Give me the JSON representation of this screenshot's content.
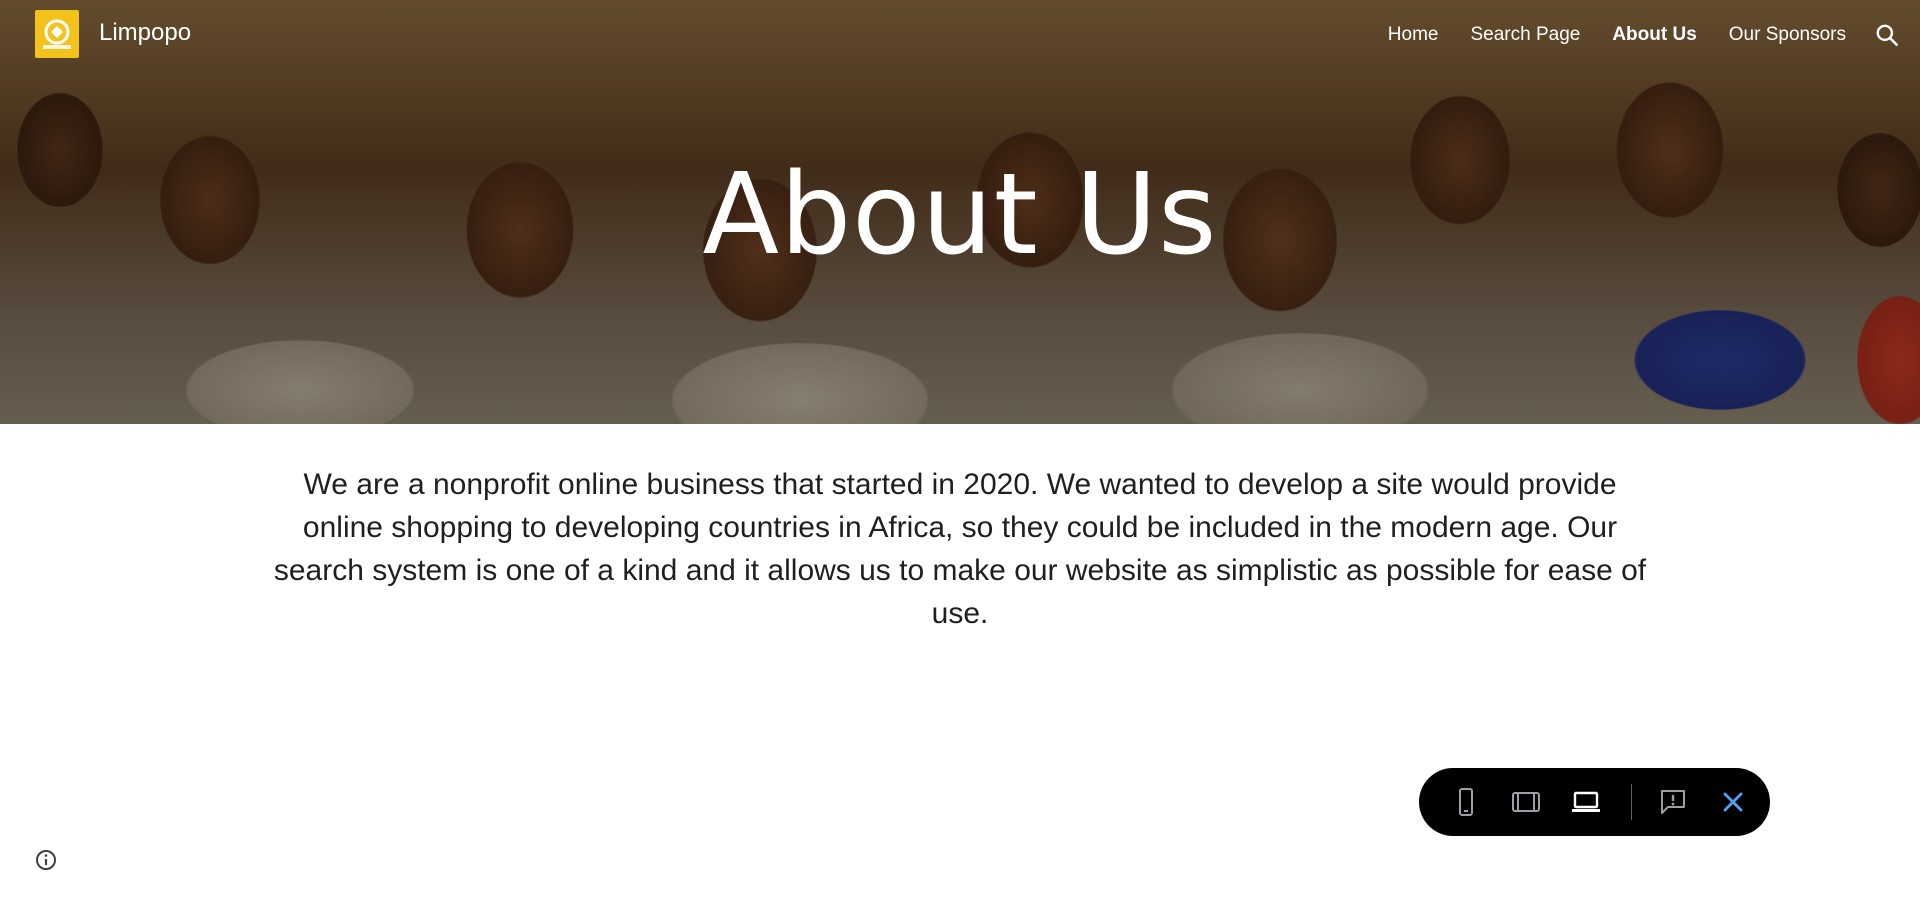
{
  "site": {
    "title": "Limpopo",
    "logo_icon": "next-gen-logo-icon",
    "logo_color": "#f3c21b"
  },
  "nav": {
    "items": [
      {
        "label": "Home",
        "active": false
      },
      {
        "label": "Search Page",
        "active": false
      },
      {
        "label": "About Us",
        "active": true
      },
      {
        "label": "Our Sponsors",
        "active": false
      }
    ],
    "search_icon": "search-icon"
  },
  "hero": {
    "title": "About Us",
    "image": "smiling-children-photo"
  },
  "content": {
    "paragraph": "We are a nonprofit online business that started in 2020. We wanted to develop a site would provide online shopping to developing countries in Africa, so they could be included in the modern age. Our search system is one of a kind and it allows us to make our website as simplistic as possible for ease of use."
  },
  "preview_toolbar": {
    "buttons": [
      "phone-icon",
      "tablet-icon",
      "laptop-icon",
      "report-abuse-icon",
      "close-icon"
    ],
    "selected": "laptop-icon",
    "close_color": "#4fa3f7"
  },
  "footer": {
    "info_icon": "info-icon"
  }
}
